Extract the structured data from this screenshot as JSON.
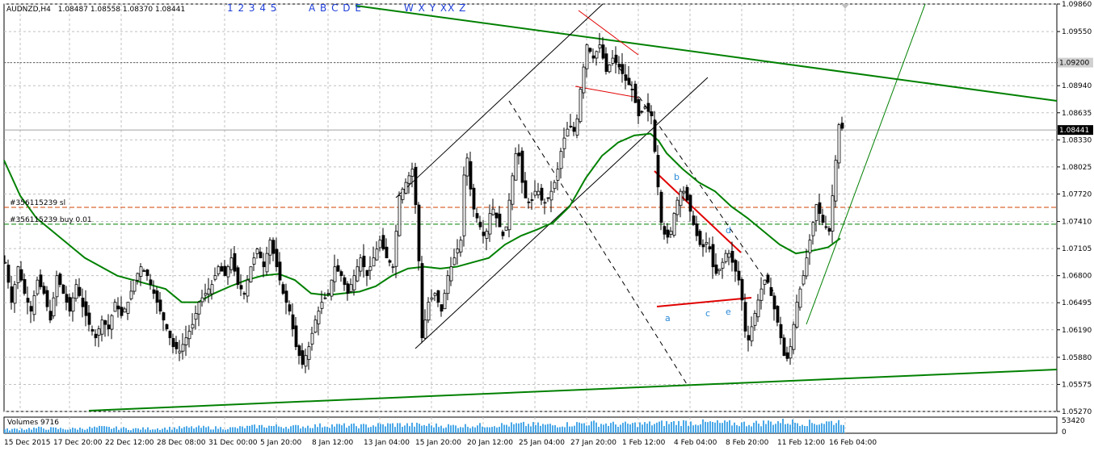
{
  "header": {
    "symbol": "AUDNZD,H4",
    "ohlc": "1.08487 1.08558 1.08370 1.08441",
    "text_numbers": "1 2 3 4 5",
    "text_letters": "A B C D E",
    "text_wave": "W X Y XX Z"
  },
  "colors": {
    "ma": "#008000",
    "trendline": "#008000",
    "candle": "#000000",
    "wedge_red": "#e00000",
    "sl_line": "#d04000",
    "buy_line": "#008000",
    "volume": "#4aa8e8",
    "label_blue": "#2a8ad8",
    "grid": "#c0c0c0",
    "current_price_marker": "#000000"
  },
  "chart_data": {
    "type": "candlestick",
    "symbol": "AUDNZD",
    "timeframe": "H4",
    "grid": true,
    "ylim": [
      1.0527,
      1.0986
    ],
    "y_ticks": [
      "1.09860",
      "1.09550",
      "1.09200",
      "1.08940",
      "1.08635",
      "1.08330",
      "1.08025",
      "1.07720",
      "1.07410",
      "1.07105",
      "1.06800",
      "1.06495",
      "1.06190",
      "1.05880",
      "1.05575",
      "1.05270"
    ],
    "x_ticks": [
      "15 Dec 2015",
      "17 Dec 20:00",
      "22 Dec 12:00",
      "28 Dec 08:00",
      "31 Dec 00:00",
      "5 Jan 20:00",
      "8 Jan 12:00",
      "13 Jan 04:00",
      "15 Jan 20:00",
      "20 Jan 12:00",
      "25 Jan 04:00",
      "27 Jan 20:00",
      "1 Feb 12:00",
      "4 Feb 04:00",
      "8 Feb 20:00",
      "11 Feb 12:00",
      "16 Feb 04:00"
    ],
    "current_price": "1.08441",
    "marked_level": "1.09200",
    "close_path": [
      [
        0,
        1.0695
      ],
      [
        8,
        1.065
      ],
      [
        16,
        1.069
      ],
      [
        24,
        1.066
      ],
      [
        32,
        1.064
      ],
      [
        40,
        1.0675
      ],
      [
        48,
        1.066
      ],
      [
        56,
        1.063
      ],
      [
        64,
        1.068
      ],
      [
        72,
        1.066
      ],
      [
        80,
        1.064
      ],
      [
        88,
        1.067
      ],
      [
        96,
        1.0645
      ],
      [
        104,
        1.0625
      ],
      [
        112,
        1.061
      ],
      [
        120,
        1.063
      ],
      [
        128,
        1.062
      ],
      [
        136,
        1.065
      ],
      [
        144,
        1.0635
      ],
      [
        152,
        1.065
      ],
      [
        160,
        1.0675
      ],
      [
        168,
        1.069
      ],
      [
        176,
        1.068
      ],
      [
        184,
        1.066
      ],
      [
        192,
        1.064
      ],
      [
        200,
        1.062
      ],
      [
        208,
        1.06
      ],
      [
        216,
        1.0595
      ],
      [
        224,
        1.061
      ],
      [
        232,
        1.0625
      ],
      [
        240,
        1.065
      ],
      [
        248,
        1.066
      ],
      [
        256,
        1.067
      ],
      [
        264,
        1.069
      ],
      [
        272,
        1.068
      ],
      [
        280,
        1.07
      ],
      [
        288,
        1.067
      ],
      [
        296,
        1.066
      ],
      [
        304,
        1.069
      ],
      [
        312,
        1.071
      ],
      [
        320,
        1.069
      ],
      [
        328,
        1.072
      ],
      [
        336,
        1.069
      ],
      [
        344,
        1.066
      ],
      [
        352,
        1.064
      ],
      [
        360,
        1.06
      ],
      [
        368,
        1.058
      ],
      [
        376,
        1.06
      ],
      [
        384,
        1.063
      ],
      [
        392,
        1.065
      ],
      [
        400,
        1.066
      ],
      [
        408,
        1.069
      ],
      [
        416,
        1.068
      ],
      [
        424,
        1.066
      ],
      [
        432,
        1.068
      ],
      [
        440,
        1.07
      ],
      [
        448,
        1.068
      ],
      [
        456,
        1.07
      ],
      [
        464,
        1.072
      ],
      [
        472,
        1.07
      ],
      [
        480,
        1.069
      ],
      [
        488,
        1.077
      ],
      [
        496,
        1.0785
      ],
      [
        504,
        1.08
      ],
      [
        510,
        1.074
      ],
      [
        516,
        1.061
      ],
      [
        524,
        1.065
      ],
      [
        532,
        1.066
      ],
      [
        540,
        1.064
      ],
      [
        548,
        1.068
      ],
      [
        556,
        1.07
      ],
      [
        564,
        1.072
      ],
      [
        570,
        1.083
      ],
      [
        578,
        1.076
      ],
      [
        586,
        1.074
      ],
      [
        594,
        1.072
      ],
      [
        602,
        1.076
      ],
      [
        610,
        1.074
      ],
      [
        618,
        1.072
      ],
      [
        626,
        1.078
      ],
      [
        634,
        1.083
      ],
      [
        642,
        1.077
      ],
      [
        650,
        1.076
      ],
      [
        658,
        1.078
      ],
      [
        666,
        1.076
      ],
      [
        674,
        1.077
      ],
      [
        682,
        1.079
      ],
      [
        690,
        1.083
      ],
      [
        698,
        1.085
      ],
      [
        706,
        1.084
      ],
      [
        712,
        1.089
      ],
      [
        720,
        1.094
      ],
      [
        728,
        1.0925
      ],
      [
        736,
        1.094
      ],
      [
        744,
        1.091
      ],
      [
        752,
        1.0925
      ],
      [
        760,
        1.0915
      ],
      [
        768,
        1.09
      ],
      [
        776,
        1.089
      ],
      [
        784,
        1.086
      ],
      [
        792,
        1.087
      ],
      [
        800,
        1.086
      ],
      [
        806,
        1.08
      ],
      [
        812,
        1.074
      ],
      [
        818,
        1.072
      ],
      [
        824,
        1.073
      ],
      [
        830,
        1.076
      ],
      [
        838,
        1.078
      ],
      [
        846,
        1.076
      ],
      [
        854,
        1.073
      ],
      [
        862,
        1.071
      ],
      [
        870,
        1.072
      ],
      [
        878,
        1.068
      ],
      [
        886,
        1.069
      ],
      [
        894,
        1.071
      ],
      [
        902,
        1.069
      ],
      [
        910,
        1.067
      ],
      [
        918,
        1.06
      ],
      [
        926,
        1.063
      ],
      [
        934,
        1.066
      ],
      [
        942,
        1.068
      ],
      [
        950,
        1.065
      ],
      [
        958,
        1.062
      ],
      [
        966,
        1.058
      ],
      [
        972,
        1.06
      ],
      [
        980,
        1.065
      ],
      [
        988,
        1.068
      ],
      [
        996,
        1.072
      ],
      [
        1004,
        1.076
      ],
      [
        1012,
        1.074
      ],
      [
        1020,
        1.073
      ],
      [
        1026,
        1.079
      ],
      [
        1032,
        1.085
      ],
      [
        1038,
        1.0844
      ]
    ],
    "ma_path": [
      [
        0,
        1.081
      ],
      [
        20,
        1.077
      ],
      [
        40,
        1.0745
      ],
      [
        60,
        1.073
      ],
      [
        80,
        1.0715
      ],
      [
        100,
        1.07
      ],
      [
        120,
        1.069
      ],
      [
        140,
        1.068
      ],
      [
        160,
        1.0675
      ],
      [
        180,
        1.067
      ],
      [
        200,
        1.0665
      ],
      [
        220,
        1.065
      ],
      [
        240,
        1.065
      ],
      [
        260,
        1.066
      ],
      [
        280,
        1.0668
      ],
      [
        300,
        1.0675
      ],
      [
        320,
        1.068
      ],
      [
        340,
        1.0682
      ],
      [
        360,
        1.0675
      ],
      [
        380,
        1.066
      ],
      [
        400,
        1.0658
      ],
      [
        420,
        1.066
      ],
      [
        440,
        1.0662
      ],
      [
        460,
        1.0668
      ],
      [
        480,
        1.068
      ],
      [
        500,
        1.0688
      ],
      [
        520,
        1.069
      ],
      [
        540,
        1.0688
      ],
      [
        560,
        1.069
      ],
      [
        580,
        1.0695
      ],
      [
        600,
        1.07
      ],
      [
        620,
        1.0715
      ],
      [
        640,
        1.0725
      ],
      [
        660,
        1.0732
      ],
      [
        680,
        1.074
      ],
      [
        700,
        1.0758
      ],
      [
        720,
        1.079
      ],
      [
        740,
        1.0815
      ],
      [
        760,
        1.083
      ],
      [
        780,
        1.0838
      ],
      [
        800,
        1.084
      ],
      [
        810,
        1.0832
      ],
      [
        820,
        1.0818
      ],
      [
        840,
        1.08
      ],
      [
        860,
        1.0785
      ],
      [
        880,
        1.0775
      ],
      [
        900,
        1.0758
      ],
      [
        920,
        1.0745
      ],
      [
        940,
        1.073
      ],
      [
        960,
        1.0715
      ],
      [
        980,
        1.0705
      ],
      [
        1000,
        1.0708
      ],
      [
        1020,
        1.0712
      ],
      [
        1035,
        1.0722
      ]
    ],
    "volume_path": [
      [
        0,
        0.25
      ],
      [
        40,
        0.35
      ],
      [
        80,
        0.3
      ],
      [
        120,
        0.4
      ],
      [
        160,
        0.3
      ],
      [
        200,
        0.35
      ],
      [
        240,
        0.4
      ],
      [
        280,
        0.35
      ],
      [
        320,
        0.5
      ],
      [
        360,
        0.45
      ],
      [
        400,
        0.55
      ],
      [
        440,
        0.5
      ],
      [
        480,
        0.6
      ],
      [
        520,
        0.55
      ],
      [
        560,
        0.5
      ],
      [
        600,
        0.55
      ],
      [
        640,
        0.6
      ],
      [
        680,
        0.55
      ],
      [
        720,
        0.7
      ],
      [
        760,
        0.6
      ],
      [
        800,
        0.65
      ],
      [
        840,
        0.75
      ],
      [
        880,
        0.7
      ],
      [
        920,
        0.65
      ],
      [
        960,
        0.8
      ],
      [
        1000,
        0.7
      ],
      [
        1035,
        0.8
      ]
    ],
    "volume_ticks": [
      "53420",
      "0"
    ]
  },
  "labels": {
    "sl_order": "#356115239 sl",
    "buy_order": "#356115239 buy 0.01",
    "volume_title": "Volumes 9716",
    "wave_a": "a",
    "wave_b": "b",
    "wave_c": "c",
    "wave_d": "d",
    "wave_e": "e"
  }
}
